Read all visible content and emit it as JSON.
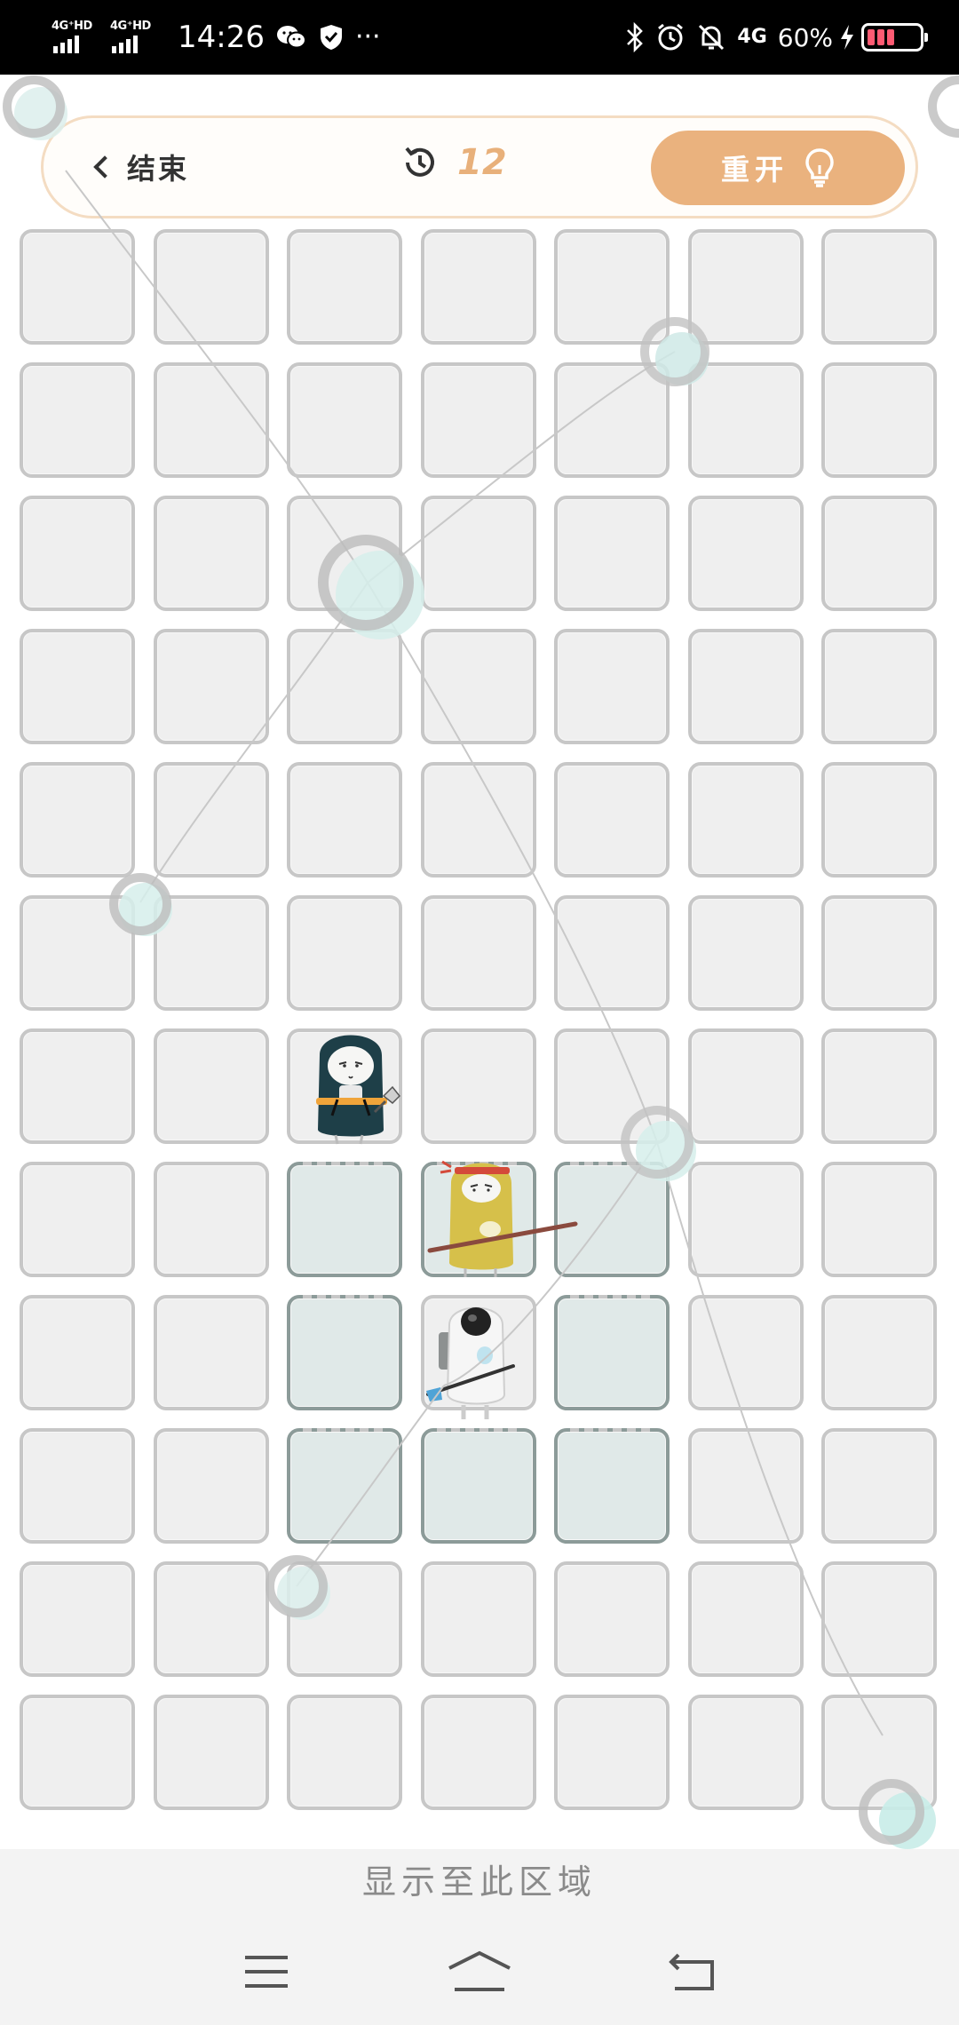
{
  "status_bar": {
    "signal1_label": "4G⁺HD",
    "signal2_label": "4G⁺HD",
    "time": "14:26",
    "network": "4G",
    "battery": "60%"
  },
  "header": {
    "back_label": "结束",
    "moves_icon": "history-icon",
    "moves_count": "12",
    "restart_label": "重开",
    "restart_icon": "lightbulb-icon"
  },
  "board": {
    "columns": 7,
    "rows": 12,
    "highlighted_cells": [
      [
        7,
        2
      ],
      [
        7,
        3
      ],
      [
        7,
        4
      ],
      [
        8,
        2
      ],
      [
        8,
        4
      ],
      [
        9,
        2
      ],
      [
        9,
        3
      ],
      [
        9,
        4
      ]
    ],
    "characters": [
      {
        "name": "ninja-character",
        "row": 6,
        "col": 2
      },
      {
        "name": "monk-character",
        "row": 7,
        "col": 3
      },
      {
        "name": "astronaut-character",
        "row": 8,
        "col": 3
      }
    ]
  },
  "footer": {
    "hint": "显示至此区域",
    "nav": [
      "menu-icon",
      "home-icon",
      "back-icon"
    ]
  },
  "colors": {
    "accent": "#eab27e",
    "cell_bg": "#efefef",
    "cell_highlight": "#e0e9e8",
    "header_border": "#f4dcc2"
  }
}
